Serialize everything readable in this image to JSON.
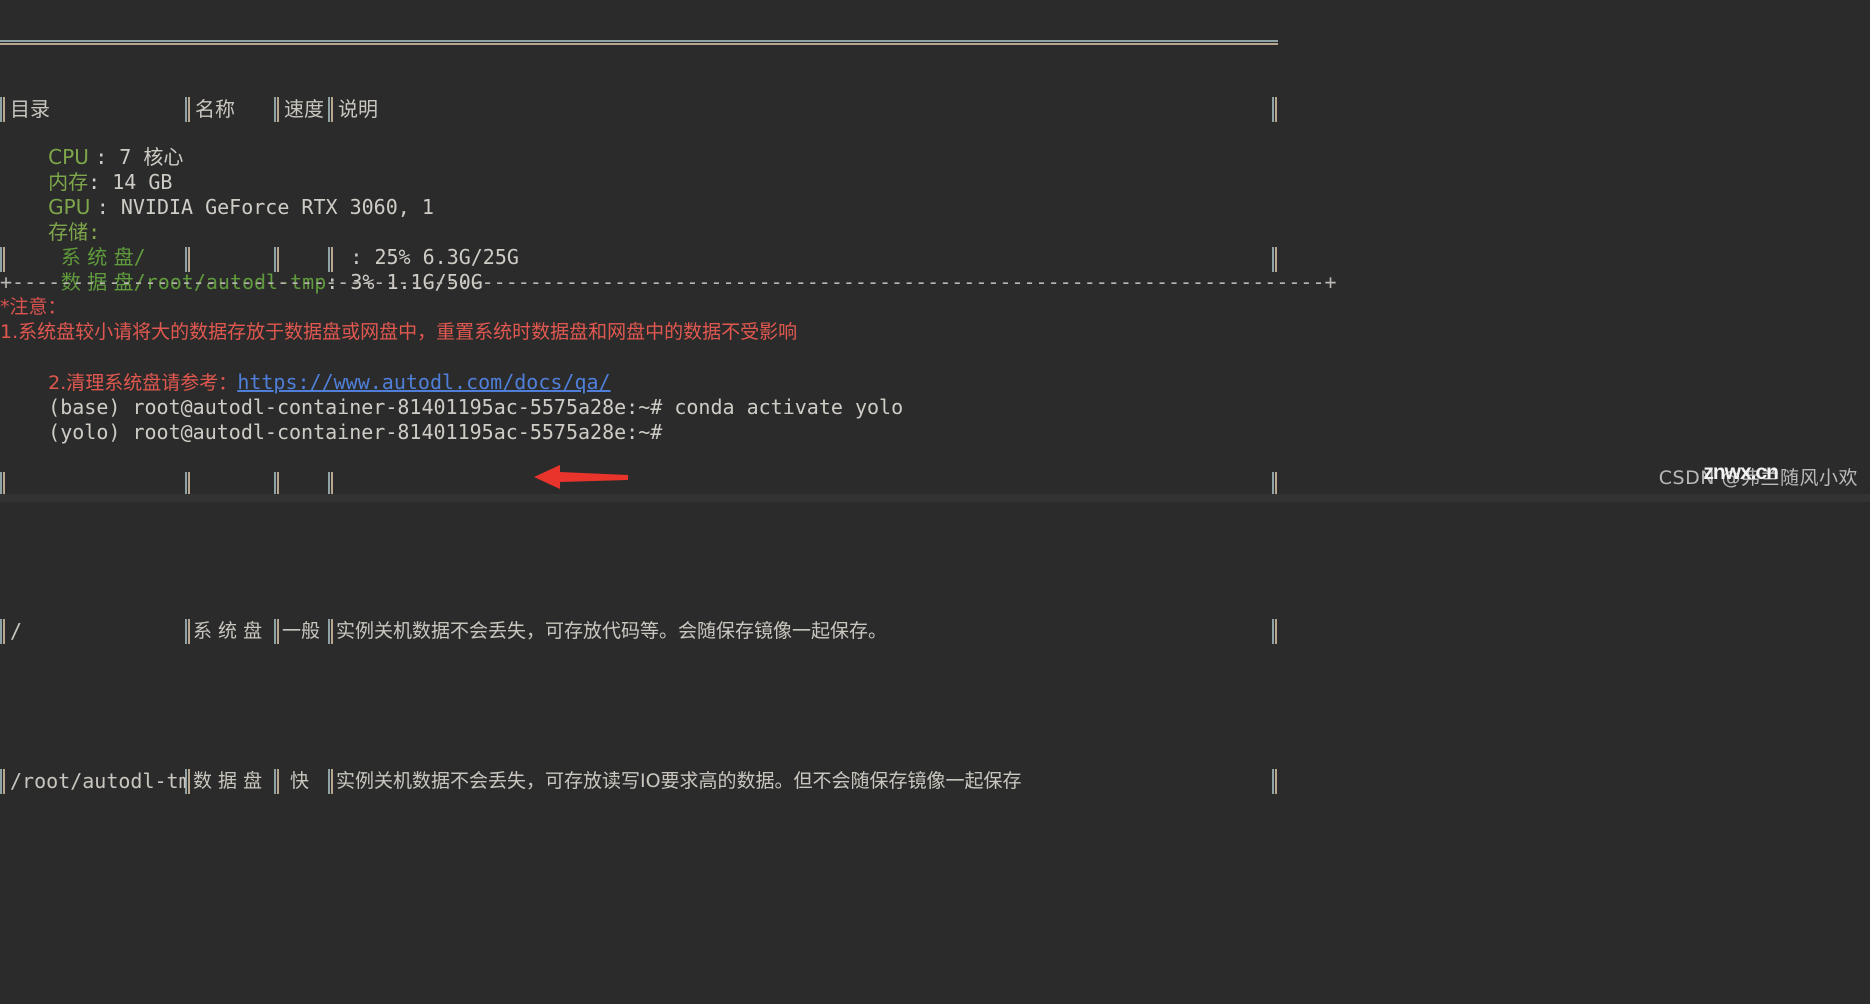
{
  "terminal": {
    "background_color": "#2b2b2b",
    "default_text_color": "#cfccc6",
    "label_color": "#7ea64b",
    "warning_color": "#d9534f",
    "link_color": "#4f7fd8"
  },
  "disk_table": {
    "headers": [
      "目录",
      "名称",
      "速度",
      "说明"
    ],
    "rows": [
      {
        "directory": "/",
        "name": "系 统 盘",
        "speed": "一般",
        "description": "实例关机数据不会丢失，可存放代码等。会随保存镜像一起保存。"
      },
      {
        "directory": "/root/autodl-tmp",
        "name": "数 据 盘",
        "speed": "快",
        "description": "实例关机数据不会丢失，可存放读写IO要求高的数据。但不会随保存镜像一起保存"
      }
    ]
  },
  "sysinfo": {
    "cpu_label": "CPU ",
    "cpu_value": ": 7 核心",
    "mem_label": "内存",
    "mem_value": ": 14 GB",
    "gpu_label": "GPU ",
    "gpu_value": ": NVIDIA GeForce RTX 3060, 1",
    "storage_label": "存储",
    "storage_colon": ":",
    "disks": [
      {
        "label": "  系 统 盘",
        "path": "/",
        "pad": "                 ",
        "usage": ": 25% 6.3G/25G"
      },
      {
        "label": "  数 据 盘",
        "path": "/root/autodl-tmp",
        "pad": "",
        "usage": ": 3% 1.1G/50G"
      }
    ]
  },
  "divider": "+-------------------------------------------------------------------------------------------------------------+",
  "notes": {
    "title": "*注意：",
    "item1": "1.系统盘较小请将大的数据存放于数据盘或网盘中，重置系统时数据盘和网盘中的数据不受影响",
    "item2_prefix": "2.清理系统盘请参考：",
    "item2_link": "https://www.autodl.com/docs/qa/"
  },
  "prompt_lines": [
    {
      "env": "(base) ",
      "user_host": "root@autodl-container-81401195ac-5575a28e:~# ",
      "command": "conda activate yolo"
    },
    {
      "env": "(yolo) ",
      "user_host": "root@autodl-container-81401195ac-5575a28e:~# ",
      "command": ""
    }
  ],
  "annotation": {
    "arrow_color": "#e8342b",
    "arrow_direction": "left"
  },
  "watermarks": {
    "csdn": "CSDN @弗兰随风小欢",
    "znwx": "znwx.cn"
  }
}
